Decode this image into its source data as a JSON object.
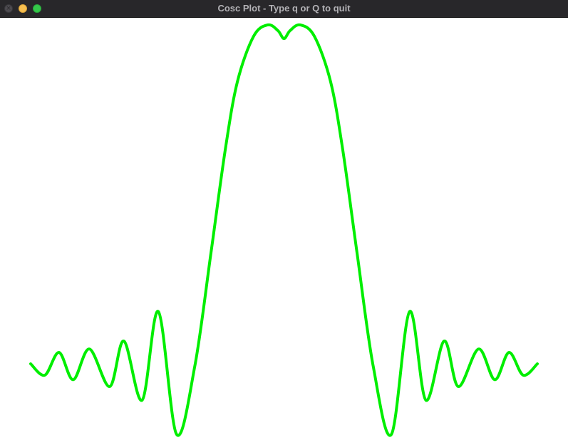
{
  "window": {
    "title": "Cosc Plot - Type q or Q to quit",
    "buttons": {
      "close": "close-icon",
      "minimize": "minimize-icon",
      "zoom": "zoom-icon"
    },
    "colors": {
      "titlebar": "#28272a",
      "title_text": "#b3b2b6",
      "canvas": "#ffffff"
    }
  },
  "chart_data": {
    "type": "line",
    "title": "",
    "xlabel": "",
    "ylabel": "",
    "grid": false,
    "axes_visible": false,
    "line_color": "#00ee00",
    "series": [
      {
        "x": [
          -12.5,
          -11.8,
          -11.1,
          -10.4,
          -9.6,
          -8.6,
          -7.9,
          -7.0,
          -6.2,
          -5.3,
          -4.4,
          -3.6,
          -2.9,
          -2.3,
          -1.5,
          -0.8,
          -0.3,
          0.0,
          0.3,
          0.8,
          1.5,
          2.3,
          2.9,
          3.6,
          4.4,
          5.3,
          6.2,
          7.0,
          7.9,
          8.6,
          9.6,
          10.4,
          11.1,
          11.8,
          12.5
        ],
        "y": [
          0.02,
          -0.08,
          0.12,
          -0.12,
          0.15,
          -0.18,
          0.22,
          -0.3,
          0.48,
          -0.6,
          0.0,
          1.0,
          1.9,
          2.5,
          2.9,
          3.0,
          2.95,
          2.88,
          2.95,
          3.0,
          2.9,
          2.5,
          1.9,
          1.0,
          0.0,
          -0.6,
          0.48,
          -0.3,
          0.22,
          -0.18,
          0.15,
          -0.12,
          0.12,
          -0.08,
          0.02
        ]
      }
    ]
  }
}
